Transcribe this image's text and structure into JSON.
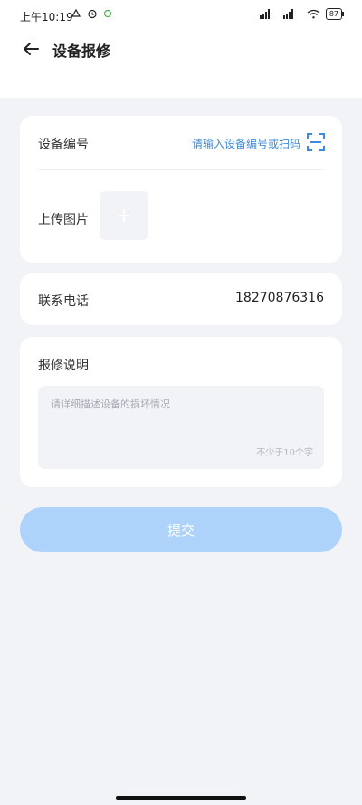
{
  "status_bar": {
    "time": "上午10:19",
    "battery": "87"
  },
  "header": {
    "title": "设备报修"
  },
  "device": {
    "label": "设备编号",
    "placeholder": "请输入设备编号或扫码"
  },
  "upload": {
    "label": "上传图片"
  },
  "contact": {
    "label": "联系电话",
    "phone": "18270876316"
  },
  "description": {
    "label": "报修说明",
    "placeholder": "请详细描述设备的损坏情况",
    "hint": "不少于10个字"
  },
  "submit_label": "提交",
  "icons": {
    "back": "arrow-left-icon",
    "scan": "scan-icon",
    "upload": "plus-icon"
  },
  "colors": {
    "accent": "#3d8bdc",
    "submit_disabled": "#aed3fb",
    "background": "#f2f3f7"
  }
}
